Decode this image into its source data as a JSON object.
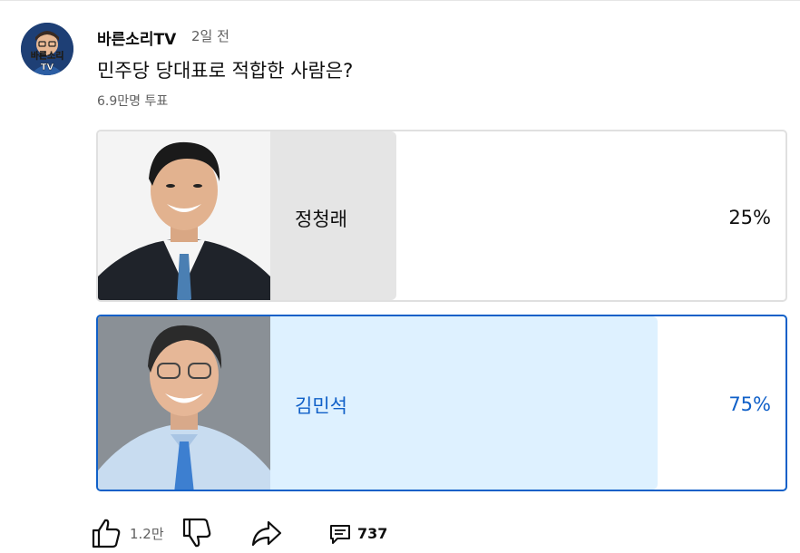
{
  "post": {
    "channel_name": "바른소리TV",
    "time_ago": "2일 전",
    "question": "민주당 당대표로 적합한 사람은?",
    "vote_count": "6.9만명 투표",
    "avatar_text": "바른소리TV"
  },
  "poll": {
    "options": [
      {
        "name": "정청래",
        "percent_label": "25%",
        "percent": 25,
        "selected": false
      },
      {
        "name": "김민석",
        "percent_label": "75%",
        "percent": 75,
        "selected": true
      }
    ]
  },
  "actions": {
    "like_count": "1.2만",
    "comment_count": "737"
  },
  "colors": {
    "accent": "#1060c8",
    "selected_bar": "#def1ff",
    "unselected_bar": "#e5e5e5",
    "secondary_text": "#606060"
  }
}
